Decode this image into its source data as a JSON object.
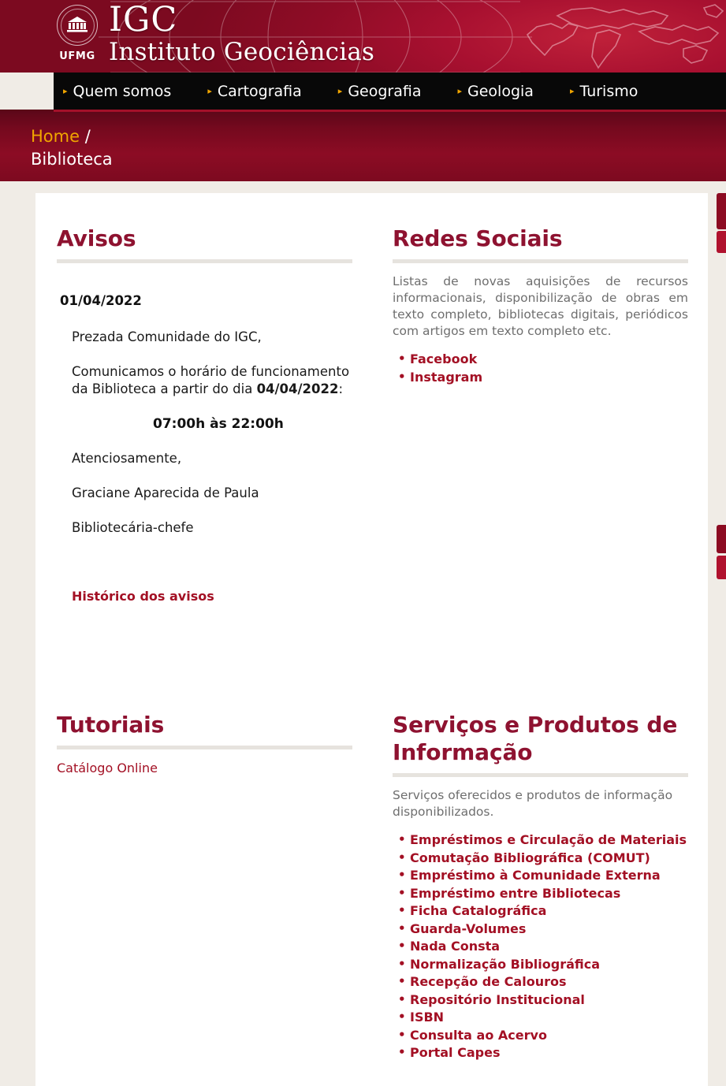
{
  "header": {
    "seal_label": "UFMG",
    "brand_acronym": "IGC",
    "brand_name": "Instituto Geociências",
    "nav": [
      {
        "label": "Quem somos",
        "icon": "arrow-right-icon"
      },
      {
        "label": "Cartografia",
        "icon": "arrow-right-icon"
      },
      {
        "label": "Geografia",
        "icon": "arrow-right-icon"
      },
      {
        "label": "Geologia",
        "icon": "arrow-right-icon"
      },
      {
        "label": "Turismo",
        "icon": "arrow-right-icon"
      }
    ]
  },
  "breadcrumb": {
    "home": "Home",
    "separator": "/",
    "current": "Biblioteca"
  },
  "avisos": {
    "title": "Avisos",
    "date": "01/04/2022",
    "greeting": "Prezada Comunidade do IGC,",
    "line_a": "Comunicamos o horário de funcionamento",
    "line_b_before": "da Biblioteca a partir do dia ",
    "line_b_bold": "04/04/2022",
    "line_b_after": ":",
    "hours": "07:00h às 22:00h",
    "closing": "Atenciosamente,",
    "signer_name": "Graciane Aparecida de Paula",
    "signer_role": "Bibliotecária-chefe",
    "history_link": "Histórico dos avisos"
  },
  "redes_sociais": {
    "title": "Redes Sociais",
    "description": "Listas de novas aquisições de recursos informacionais, disponibilização de obras em texto completo, bibliotecas digitais, periódicos com artigos em texto completo etc.",
    "links": [
      {
        "label": "Facebook"
      },
      {
        "label": "Instagram"
      }
    ]
  },
  "tutoriais": {
    "title": "Tutoriais",
    "links": [
      {
        "label": "Catálogo Online"
      }
    ]
  },
  "servicos": {
    "title": "Serviços e Produtos de Informação",
    "description": "Serviços oferecidos e produtos de informação disponibilizados.",
    "links": [
      {
        "label": "Empréstimos e Circulação de Materiais"
      },
      {
        "label": "Comutação Bibliográfica (COMUT)"
      },
      {
        "label": "Empréstimo à Comunidade Externa"
      },
      {
        "label": "Empréstimo entre Bibliotecas"
      },
      {
        "label": "Ficha Catalográfica"
      },
      {
        "label": "Guarda-Volumes"
      },
      {
        "label": "Nada Consta"
      },
      {
        "label": "Normalização Bibliográfica"
      },
      {
        "label": "Recepção de Calouros"
      },
      {
        "label": "Repositório Institucional"
      },
      {
        "label": "ISBN"
      },
      {
        "label": "Consulta ao Acervo"
      },
      {
        "label": "Portal Capes"
      }
    ]
  },
  "side_tabs": [
    {
      "name": "side-tab-1"
    },
    {
      "name": "side-tab-2"
    },
    {
      "name": "side-tab-3"
    },
    {
      "name": "side-tab-4"
    }
  ],
  "colors": {
    "brand_red": "#8e1230",
    "link_red": "#a31024",
    "accent_gold": "#f0a500",
    "page_bg": "#f0ece6",
    "nav_bg": "#080808",
    "rule": "#e6e3de"
  }
}
